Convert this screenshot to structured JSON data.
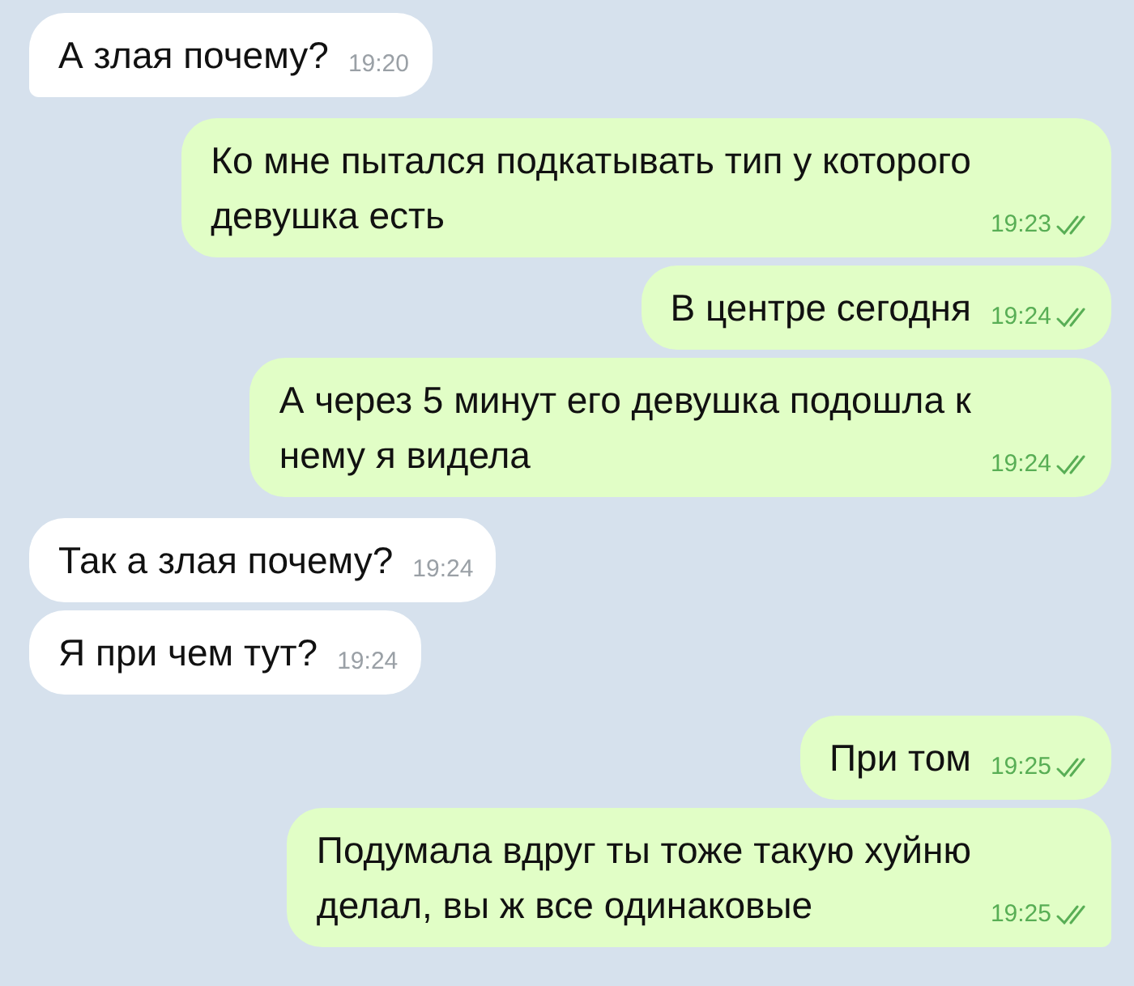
{
  "messages": [
    {
      "kind": "in",
      "text": "А злая почему?",
      "time": "19:20",
      "tail": true
    },
    {
      "kind": "out",
      "text": "Ко мне пытался подкатывать тип у которого\nдевушка есть",
      "time": "19:23",
      "read": true,
      "tail": false
    },
    {
      "kind": "out",
      "text": "В центре сегодня",
      "time": "19:24",
      "read": true,
      "tail": false
    },
    {
      "kind": "out",
      "text": "А через 5 минут его девушка подошла к\nнему я видела",
      "time": "19:24",
      "read": true,
      "tail": false
    },
    {
      "kind": "in",
      "text": "Так а злая почему?",
      "time": "19:24",
      "tail": false
    },
    {
      "kind": "in",
      "text": "Я при чем тут?",
      "time": "19:24",
      "tail": false
    },
    {
      "kind": "out",
      "text": "При том",
      "time": "19:25",
      "read": true,
      "tail": false
    },
    {
      "kind": "out",
      "text": "Подумала вдруг ты тоже такую хуйню\nделал, вы ж все одинаковые",
      "time": "19:25",
      "read": true,
      "tail": true
    }
  ]
}
